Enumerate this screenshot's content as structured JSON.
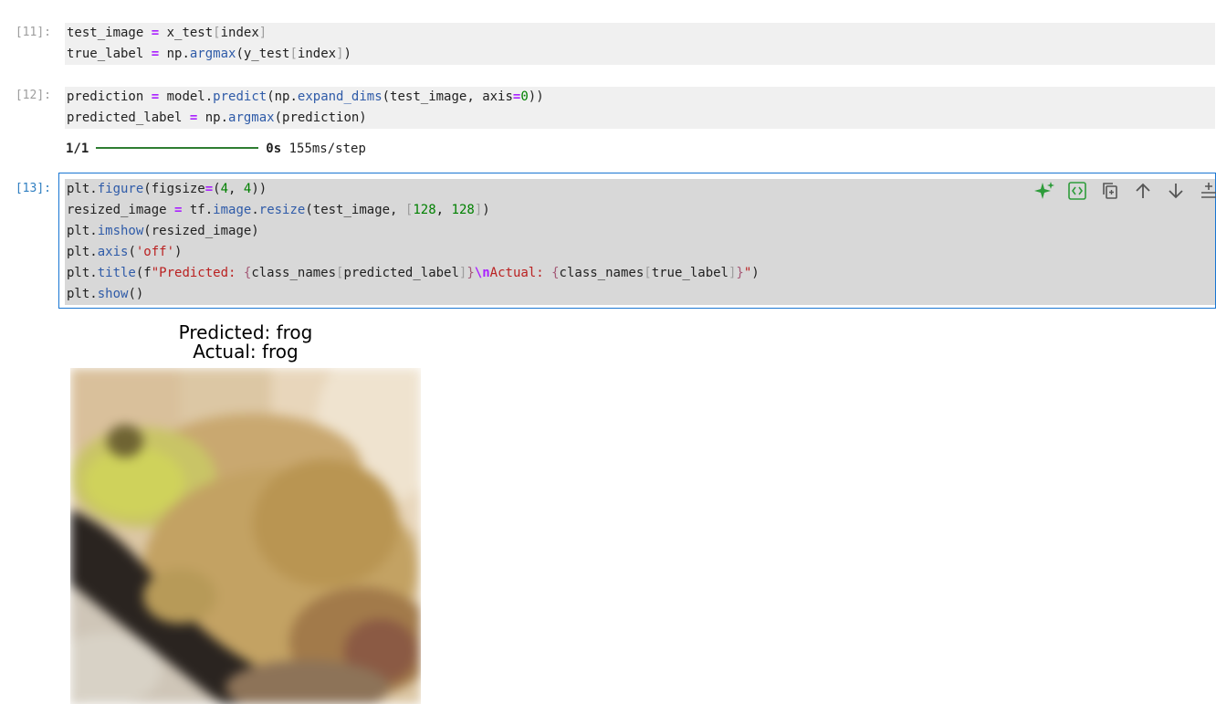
{
  "cells": [
    {
      "prompt": "[11]:",
      "lines": [
        [
          [
            "n",
            "test_image "
          ],
          [
            "k",
            "="
          ],
          [
            "n",
            " x_test"
          ],
          [
            "br",
            "["
          ],
          [
            "n",
            "index"
          ],
          [
            "br",
            "]"
          ]
        ],
        [
          [
            "n",
            "true_label "
          ],
          [
            "k",
            "="
          ],
          [
            "n",
            " np."
          ],
          [
            "a",
            "argmax"
          ],
          [
            "n",
            "(y_test"
          ],
          [
            "br",
            "["
          ],
          [
            "n",
            "index"
          ],
          [
            "br",
            "]"
          ],
          [
            "n",
            ")"
          ]
        ]
      ]
    },
    {
      "prompt": "[12]:",
      "lines": [
        [
          [
            "n",
            "prediction "
          ],
          [
            "k",
            "="
          ],
          [
            "n",
            " model."
          ],
          [
            "a",
            "predict"
          ],
          [
            "n",
            "(np."
          ],
          [
            "a",
            "expand_dims"
          ],
          [
            "n",
            "(test_image, axis"
          ],
          [
            "k",
            "="
          ],
          [
            "num",
            "0"
          ],
          [
            "n",
            "))"
          ]
        ],
        [
          [
            "n",
            "predicted_label "
          ],
          [
            "k",
            "="
          ],
          [
            "n",
            " np."
          ],
          [
            "a",
            "argmax"
          ],
          [
            "n",
            "(prediction)"
          ]
        ]
      ],
      "output": {
        "left": "1/1",
        "time": "0s",
        "rest": " 155ms/step"
      }
    },
    {
      "prompt": "[13]:",
      "lines": [
        [
          [
            "n",
            "plt."
          ],
          [
            "a",
            "figure"
          ],
          [
            "n",
            "(figsize"
          ],
          [
            "k",
            "="
          ],
          [
            "n",
            "("
          ],
          [
            "num",
            "4"
          ],
          [
            "n",
            ", "
          ],
          [
            "num",
            "4"
          ],
          [
            "n",
            "))"
          ]
        ],
        [
          [
            "n",
            "resized_image "
          ],
          [
            "k",
            "="
          ],
          [
            "n",
            " tf."
          ],
          [
            "a",
            "image"
          ],
          [
            "n",
            "."
          ],
          [
            "a",
            "resize"
          ],
          [
            "n",
            "(test_image, "
          ],
          [
            "br",
            "["
          ],
          [
            "num",
            "128"
          ],
          [
            "n",
            ", "
          ],
          [
            "num",
            "128"
          ],
          [
            "br",
            "]"
          ],
          [
            "n",
            ")"
          ]
        ],
        [
          [
            "n",
            "plt."
          ],
          [
            "a",
            "imshow"
          ],
          [
            "n",
            "(resized_image)"
          ]
        ],
        [
          [
            "n",
            "plt."
          ],
          [
            "a",
            "axis"
          ],
          [
            "n",
            "("
          ],
          [
            "s",
            "'off'"
          ],
          [
            "n",
            ")"
          ]
        ],
        [
          [
            "n",
            "plt."
          ],
          [
            "a",
            "title"
          ],
          [
            "n",
            "(f"
          ],
          [
            "s",
            "\"Predicted: "
          ],
          [
            "si",
            "{"
          ],
          [
            "n",
            "class_names"
          ],
          [
            "br",
            "["
          ],
          [
            "n",
            "predicted_label"
          ],
          [
            "br",
            "]"
          ],
          [
            "si",
            "}"
          ],
          [
            "k",
            "\\n"
          ],
          [
            "s",
            "Actual: "
          ],
          [
            "si",
            "{"
          ],
          [
            "n",
            "class_names"
          ],
          [
            "br",
            "["
          ],
          [
            "n",
            "true_label"
          ],
          [
            "br",
            "]"
          ],
          [
            "si",
            "}"
          ],
          [
            "s",
            "\""
          ],
          [
            "n",
            ")"
          ]
        ],
        [
          [
            "n",
            "plt."
          ],
          [
            "a",
            "show"
          ],
          [
            "n",
            "()"
          ]
        ]
      ],
      "output_plot": {
        "title_line1": "Predicted: frog",
        "title_line2": "Actual: frog"
      }
    }
  ],
  "toolbar": {
    "icons": [
      "sparkle-icon",
      "code-brackets-icon",
      "duplicate-icon",
      "move-up-icon",
      "move-down-icon",
      "insert-below-icon"
    ],
    "accent": "#2e9c3b"
  }
}
